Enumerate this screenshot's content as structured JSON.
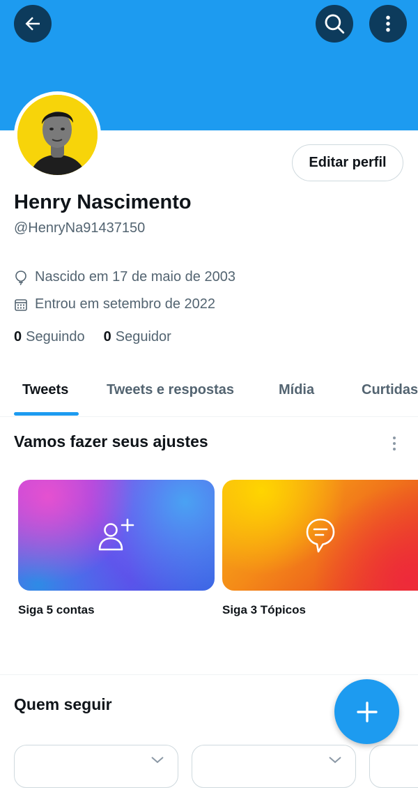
{
  "header": {
    "back_icon": "arrow-left-icon",
    "search_icon": "search-icon",
    "more_icon": "more-vertical-icon",
    "banner_color": "#1d9bf0"
  },
  "profile": {
    "name": "Henry Nascimento",
    "handle": "@HenryNa91437150",
    "edit_label": "Editar perfil",
    "birthday": "Nascido em 17 de maio de 2003",
    "joined": "Entrou em setembro de 2022",
    "following_count": "0",
    "following_label": "Seguindo",
    "followers_count": "0",
    "followers_label": "Seguidor"
  },
  "tabs": [
    {
      "label": "Tweets",
      "active": true
    },
    {
      "label": "Tweets e respostas",
      "active": false
    },
    {
      "label": "Mídia",
      "active": false
    },
    {
      "label": "Curtidas",
      "active": false
    }
  ],
  "setup": {
    "title": "Vamos fazer seus ajustes",
    "cards": [
      {
        "label": "Siga 5 contas",
        "icon": "add-user-icon"
      },
      {
        "label": "Siga 3 Tópicos",
        "icon": "topic-bubble-icon"
      }
    ]
  },
  "who_to_follow": {
    "title": "Quem seguir"
  },
  "fab": {
    "icon": "plus-icon"
  },
  "colors": {
    "accent": "#1d9bf0",
    "secondary_text": "#536471"
  }
}
